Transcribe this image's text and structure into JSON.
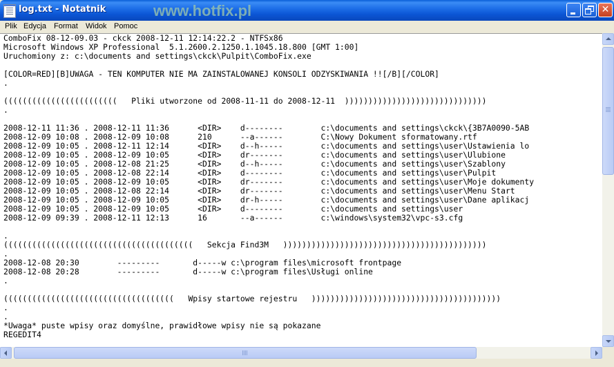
{
  "window": {
    "title": "log.txt - Notatnik",
    "watermark": "www.hotfix.pl",
    "close_glyph": "✕"
  },
  "menu": {
    "items": [
      {
        "label": "Plik"
      },
      {
        "label": "Edycja"
      },
      {
        "label": "Format"
      },
      {
        "label": "Widok"
      },
      {
        "label": "Pomoc"
      }
    ]
  },
  "content": {
    "lines": [
      "ComboFix 08-12-09.03 - ckck 2008-12-11 12:14:22.2 - NTFSx86",
      "Microsoft Windows XP Professional  5.1.2600.2.1250.1.1045.18.800 [GMT 1:00]",
      "Uruchomiony z: c:\\documents and settings\\ckck\\Pulpit\\ComboFix.exe",
      "",
      "[COLOR=RED][B]UWAGA - TEN KOMPUTER NIE MA ZAINSTALOWANEJ KONSOLI ODZYSKIWANIA !![/B][/COLOR]",
      ".",
      "",
      "((((((((((((((((((((((((   Pliki utworzone od 2008-11-11 do 2008-12-11  ))))))))))))))))))))))))))))))",
      ".",
      "",
      "2008-12-11 11:36 . 2008-12-11 11:36      <DIR>    d--------        c:\\documents and settings\\ckck\\{3B7A0090-5AB",
      "2008-12-09 10:08 . 2008-12-09 10:08      210      --a------        C:\\Nowy Dokument sformatowany.rtf",
      "2008-12-09 10:05 . 2008-12-11 12:14      <DIR>    d--h-----        c:\\documents and settings\\user\\Ustawienia lo",
      "2008-12-09 10:05 . 2008-12-09 10:05      <DIR>    dr-------        c:\\documents and settings\\user\\Ulubione",
      "2008-12-09 10:05 . 2008-12-08 21:25      <DIR>    d--h-----        c:\\documents and settings\\user\\Szablony",
      "2008-12-09 10:05 . 2008-12-08 22:14      <DIR>    d--------        c:\\documents and settings\\user\\Pulpit",
      "2008-12-09 10:05 . 2008-12-09 10:05      <DIR>    dr-------        c:\\documents and settings\\user\\Moje dokumenty",
      "2008-12-09 10:05 . 2008-12-08 22:14      <DIR>    dr-------        c:\\documents and settings\\user\\Menu Start",
      "2008-12-09 10:05 . 2008-12-09 10:05      <DIR>    dr-h-----        c:\\documents and settings\\user\\Dane aplikacj",
      "2008-12-09 10:05 . 2008-12-09 10:05      <DIR>    d--------        c:\\documents and settings\\user",
      "2008-12-09 09:39 . 2008-12-11 12:13      16       --a------        c:\\windows\\system32\\vpc-s3.cfg",
      "",
      ".",
      "((((((((((((((((((((((((((((((((((((((((   Sekcja Find3M   )))))))))))))))))))))))))))))))))))))))))))",
      ".",
      "2008-12-08 20:30        ---------       d-----w c:\\program files\\microsoft frontpage",
      "2008-12-08 20:28        ---------       d-----w c:\\program files\\Usługi online",
      ".",
      "",
      "((((((((((((((((((((((((((((((((((((   Wpisy startowe rejestru   ))))))))))))))))))))))))))))))))))))))))",
      ".",
      ".",
      "*Uwaga* puste wpisy oraz domyślne, prawidłowe wpisy nie są pokazane",
      "REGEDIT4"
    ]
  }
}
